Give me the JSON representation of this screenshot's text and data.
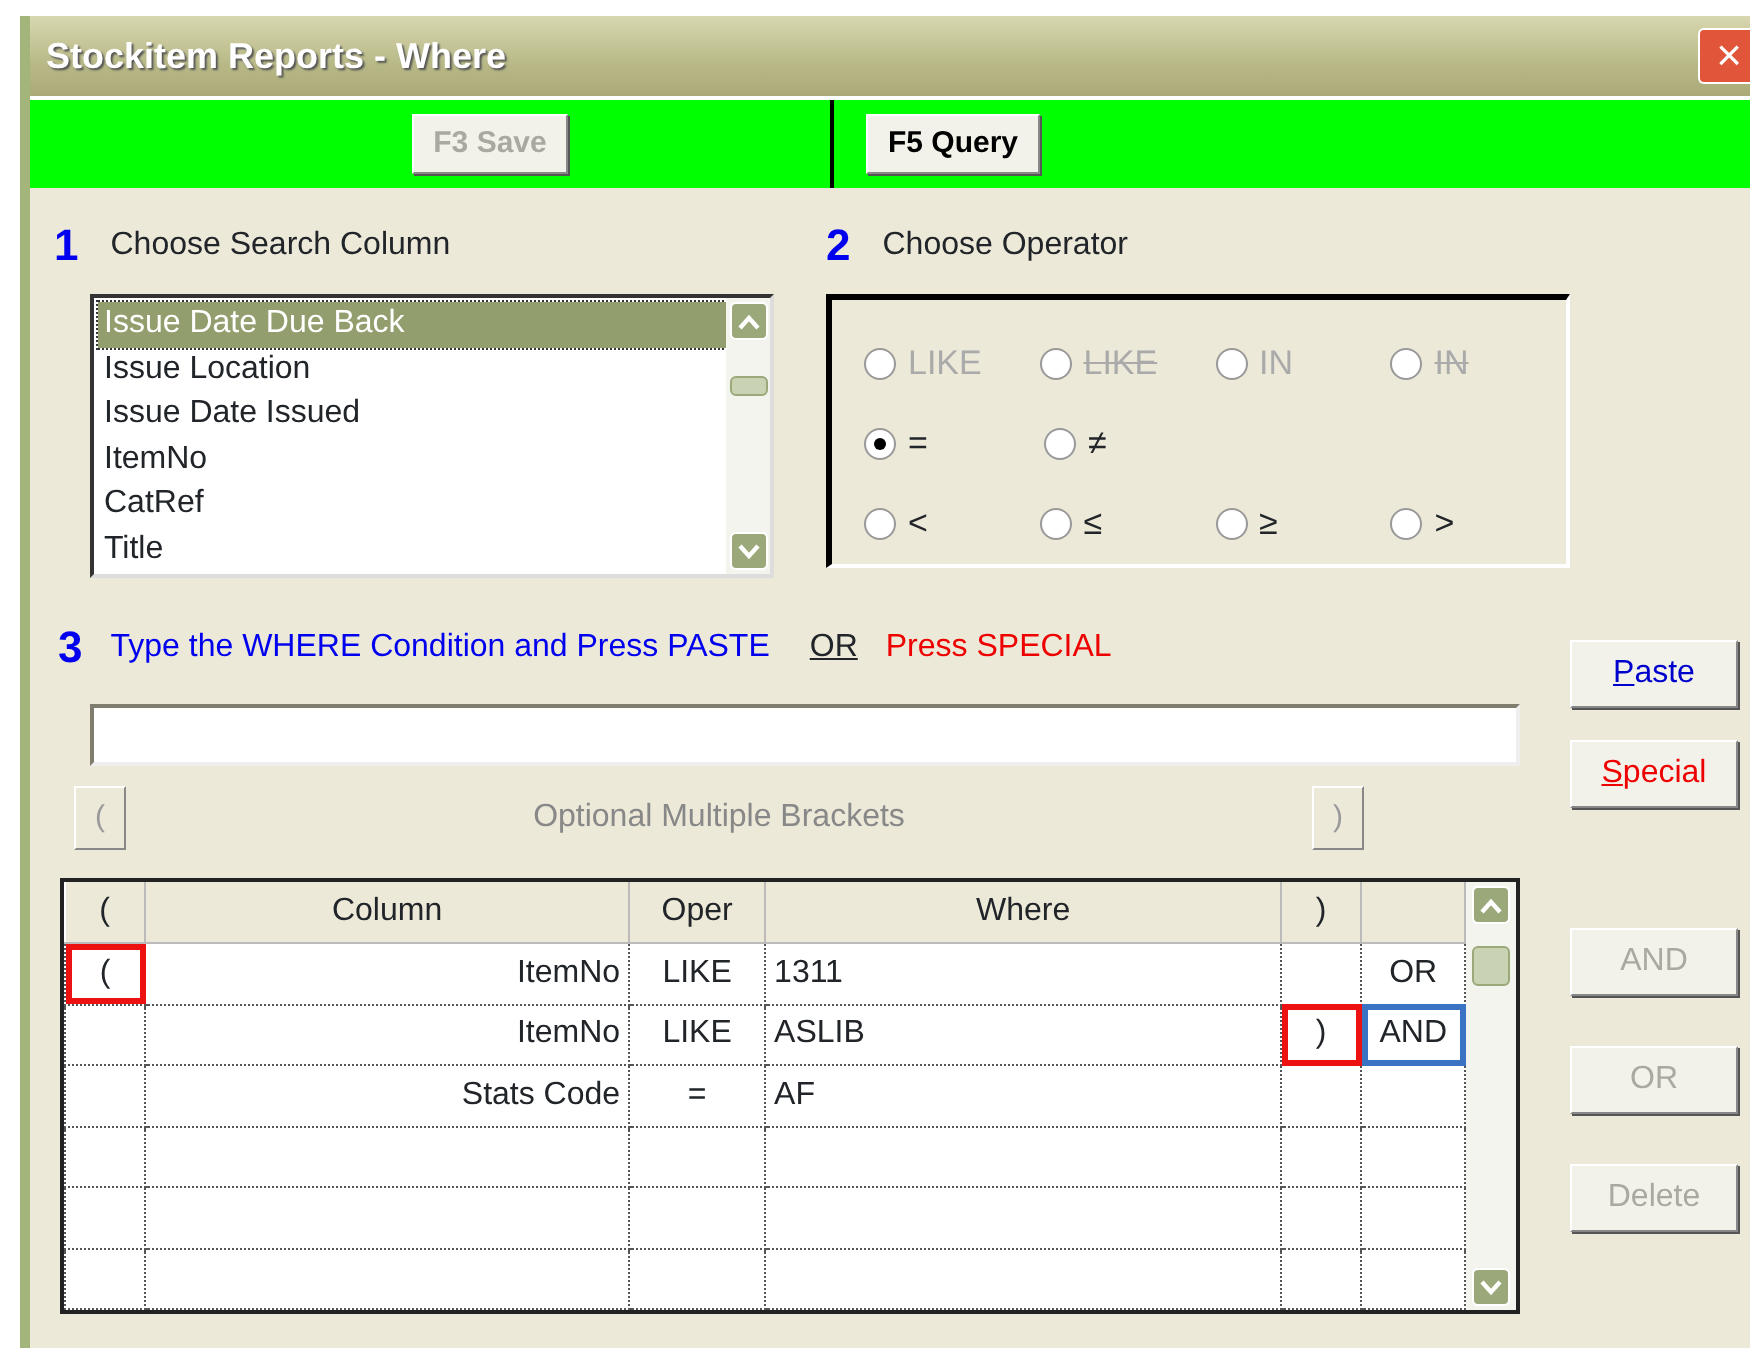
{
  "window": {
    "title": "Stockitem Reports - Where",
    "close": "×"
  },
  "toolbar": {
    "buttons": [
      {
        "label": "F3 Save",
        "disabled": true
      },
      {
        "label": "F5 Query",
        "disabled": false
      }
    ]
  },
  "step1": {
    "number": "1",
    "label": "Choose Search Column",
    "items": [
      {
        "label": "Issue Date Due Back",
        "selected": true
      },
      {
        "label": "Issue Location",
        "selected": false
      },
      {
        "label": "Issue Date Issued",
        "selected": false
      },
      {
        "label": "ItemNo",
        "selected": false
      },
      {
        "label": "CatRef",
        "selected": false
      },
      {
        "label": "Title",
        "selected": false
      }
    ]
  },
  "step2": {
    "number": "2",
    "label": "Choose Operator",
    "rows": [
      [
        {
          "label": "LIKE",
          "negated": false,
          "disabled": true,
          "selected": false
        },
        {
          "label": "LIKE",
          "negated": true,
          "disabled": true,
          "selected": false
        },
        {
          "label": "IN",
          "negated": false,
          "disabled": true,
          "selected": false
        },
        {
          "label": "IN",
          "negated": true,
          "disabled": true,
          "selected": false
        }
      ],
      [
        {
          "label": "=",
          "negated": false,
          "disabled": false,
          "selected": true
        },
        {
          "label": "≠",
          "negated": false,
          "disabled": false,
          "selected": false
        }
      ],
      [
        {
          "label": "<",
          "negated": false,
          "disabled": false,
          "selected": false
        },
        {
          "label": "≤",
          "negated": false,
          "disabled": false,
          "selected": false
        },
        {
          "label": "≥",
          "negated": false,
          "disabled": false,
          "selected": false
        },
        {
          "label": ">",
          "negated": false,
          "disabled": false,
          "selected": false
        }
      ]
    ]
  },
  "step3": {
    "number": "3",
    "instruction": "Type the WHERE Condition and Press PASTE",
    "or": "OR",
    "special_hint": "Press SPECIAL",
    "buttons": [
      {
        "label": "Paste",
        "color": "#0000cc"
      },
      {
        "label": "Special",
        "color": "#ee0000"
      }
    ],
    "brackets": {
      "open": "(",
      "caption": "Optional Multiple Brackets",
      "close": ")"
    }
  },
  "grid": {
    "columns": [
      "(",
      "Column",
      "Oper",
      "Where",
      ")"
    ],
    "rows": [
      {
        "open": "(",
        "column": "ItemNo",
        "oper": "LIKE",
        "where": "1311",
        "join": "OR",
        "marks": {
          "open": {
            "color": "#ee1111"
          }
        }
      },
      {
        "column": "ItemNo",
        "oper": "LIKE",
        "where": "ASLIB",
        "close": ")",
        "join": "AND",
        "marks": {
          "close": {
            "color": "#ee1111"
          },
          "join": {
            "color": "#3b73c4"
          }
        }
      },
      {
        "column": "Stats Code",
        "oper": "=",
        "where": "AF"
      }
    ]
  },
  "side_buttons": [
    {
      "label": "AND",
      "disabled": true
    },
    {
      "label": "OR",
      "disabled": true
    },
    {
      "label": "Delete",
      "disabled": true
    }
  ]
}
